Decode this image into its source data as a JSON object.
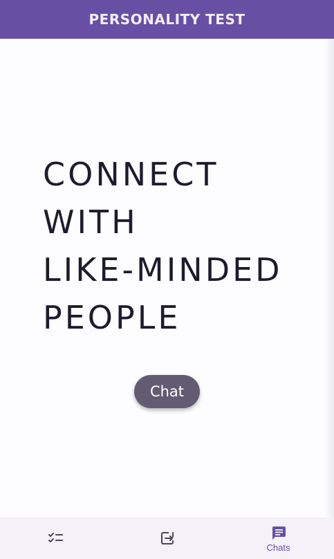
{
  "appbar": {
    "title": "PERSONALITY TEST"
  },
  "main": {
    "headline_lines": [
      "CONNECT",
      "WITH",
      "LIKE-MINDED",
      "PEOPLE"
    ],
    "chat_button_label": "Chat"
  },
  "bottom_nav": {
    "items": [
      {
        "icon": "checklist-icon",
        "label": "",
        "selected": false
      },
      {
        "icon": "exit-to-app-icon",
        "label": "",
        "selected": false
      },
      {
        "icon": "chat-bubble-icon",
        "label": "Chats",
        "selected": true
      }
    ]
  },
  "colors": {
    "primary": "#6750a4",
    "button": "#625b71",
    "text": "#1f1b2e",
    "nav_background": "#f4f1f9"
  }
}
